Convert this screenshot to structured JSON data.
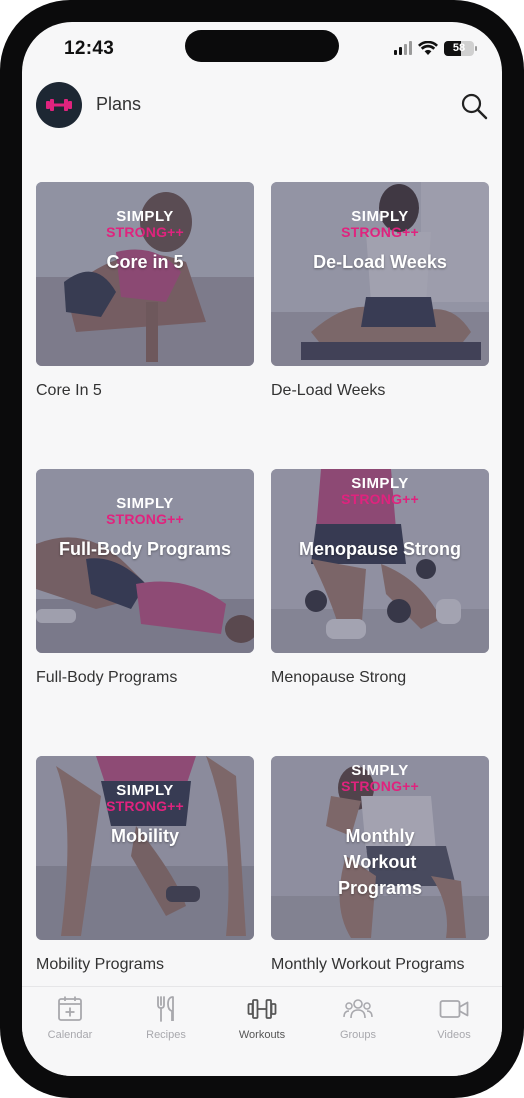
{
  "status_bar": {
    "time": "12:43",
    "battery": "58",
    "battery_level": 0.58
  },
  "header": {
    "title": "Plans"
  },
  "icons": {
    "logo": "dumbbell-icon",
    "search": "search-icon"
  },
  "colors": {
    "accent": "#e0237e",
    "logo_bg": "#1d2733"
  },
  "plans": [
    {
      "brand_top": "SIMPLY",
      "brand_bottom": "STRONG++",
      "overlay": "Core in 5",
      "label": "Core In 5"
    },
    {
      "brand_top": "SIMPLY",
      "brand_bottom": "STRONG++",
      "overlay": "De-Load Weeks",
      "label": "De-Load Weeks"
    },
    {
      "brand_top": "SIMPLY",
      "brand_bottom": "STRONG++",
      "overlay": "Full-Body Programs",
      "label": "Full-Body Programs"
    },
    {
      "brand_top": "SIMPLY",
      "brand_bottom": "STRONG++",
      "overlay": "Menopause Strong",
      "label": "Menopause Strong"
    },
    {
      "brand_top": "SIMPLY",
      "brand_bottom": "STRONG++",
      "overlay": "Mobility",
      "label": "Mobility Programs"
    },
    {
      "brand_top": "SIMPLY",
      "brand_bottom": "STRONG++",
      "overlay": "Monthly Workout Programs",
      "label": "Monthly Workout Programs"
    }
  ],
  "tabs": [
    {
      "label": "Calendar",
      "icon": "calendar-icon",
      "active": false
    },
    {
      "label": "Recipes",
      "icon": "fork-knife-icon",
      "active": false
    },
    {
      "label": "Workouts",
      "icon": "dumbbell-icon",
      "active": true
    },
    {
      "label": "Groups",
      "icon": "group-icon",
      "active": false
    },
    {
      "label": "Videos",
      "icon": "video-camera-icon",
      "active": false
    }
  ]
}
